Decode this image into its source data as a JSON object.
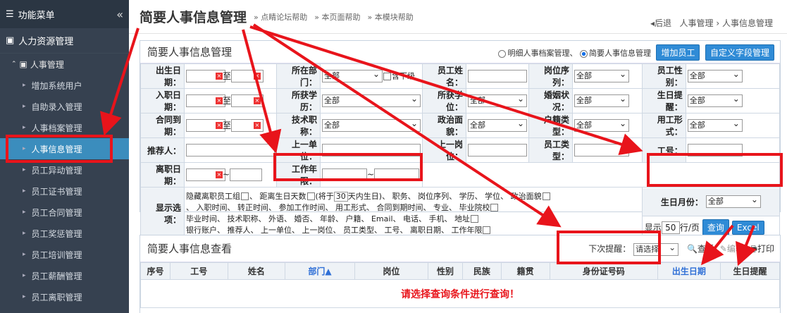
{
  "sidebar": {
    "title": "功能菜单",
    "section": "人力资源管理",
    "group": "人事管理",
    "items": [
      "增加系统用户",
      "自助录入管理",
      "人事档案管理",
      "人事信息管理",
      "员工异动管理",
      "员工证书管理",
      "员工合同管理",
      "员工奖惩管理",
      "员工培训管理",
      "员工薪酬管理",
      "员工离职管理"
    ]
  },
  "header": {
    "title": "简要人事信息管理",
    "help1": "» 点睛论坛帮助",
    "help2": "» 本页面帮助",
    "help3": "» 本模块帮助",
    "back": "◂后退",
    "crumb1": "人事管理",
    "crumb_sep": "›",
    "crumb2": "人事信息管理"
  },
  "panel1": {
    "title": "简要人事信息管理",
    "radio1": "明细人事档案管理、",
    "radio2": "简要人事信息管理",
    "btn_add": "增加员工",
    "btn_custom": "自定义字段管理"
  },
  "form": {
    "birth": "出生日期：",
    "dept": "所在部门：",
    "emp_name": "员工姓名：",
    "post_seq": "岗位序列：",
    "gender": "员工性别：",
    "join": "入职日期：",
    "edu": "所获学历：",
    "degree": "所获学位：",
    "marital": "婚姻状况：",
    "birth_remind": "生日提醒：",
    "contract": "合同到期：",
    "title_rank": "技术职称：",
    "politics": "政治面貌：",
    "household": "户籍类型：",
    "emp_form": "用工形式：",
    "referrer": "推荐人：",
    "prev_unit": "上一单位：",
    "prev_post": "上一岗位：",
    "emp_type": "员工类型：",
    "emp_no": "工号：",
    "leave": "离职日期：",
    "work_years": "工作年限：",
    "display": "显示选项：",
    "birth_month": "生日月份：",
    "to": "至",
    "tilde": "~",
    "all": "全部",
    "include_sub": "含下级",
    "options_a": "隐藏离职员工组",
    "days_label": "距离生日天数",
    "days_pre": "(将于",
    "days_val": "30",
    "days_post": "天内生日)、",
    "options_line1": "职务、 岗位序列、 学历、 学位、 政治面貌",
    "options_line2": "、 入职时间、 转正时间、 参加工作时间、 用工形式、 合同到期时间、 专业、 毕业院校",
    "options_line3": "毕业时间、 技术职称、 外语、 婚否、 年龄、 户籍、 Email、 电话、 手机、 地址",
    "options_line4": "银行账户、 推荐人、 上一单位、 上一岗位、 员工类型、 工号、 离职日期、 工作年限",
    "show": "显示",
    "per_page": "50",
    "per_page_unit": "行/页",
    "query": "查询",
    "excel": "Excel"
  },
  "panel2": {
    "title": "简要人事信息查看",
    "next_remind": "下次提醒：",
    "please": "请选择",
    "view": "查看",
    "edit": "编辑",
    "print": "打印",
    "cols": [
      "序号",
      "工号",
      "姓名",
      "部门▲",
      "岗位",
      "性别",
      "民族",
      "籍贯",
      "身份证号码",
      "出生日期",
      "生日提醒"
    ],
    "empty": "请选择查询条件进行查询！"
  },
  "colors": {
    "sidebar": "#364150",
    "accent": "#3b8dbd",
    "red": "#e8141b",
    "link": "#2f6fd6"
  }
}
